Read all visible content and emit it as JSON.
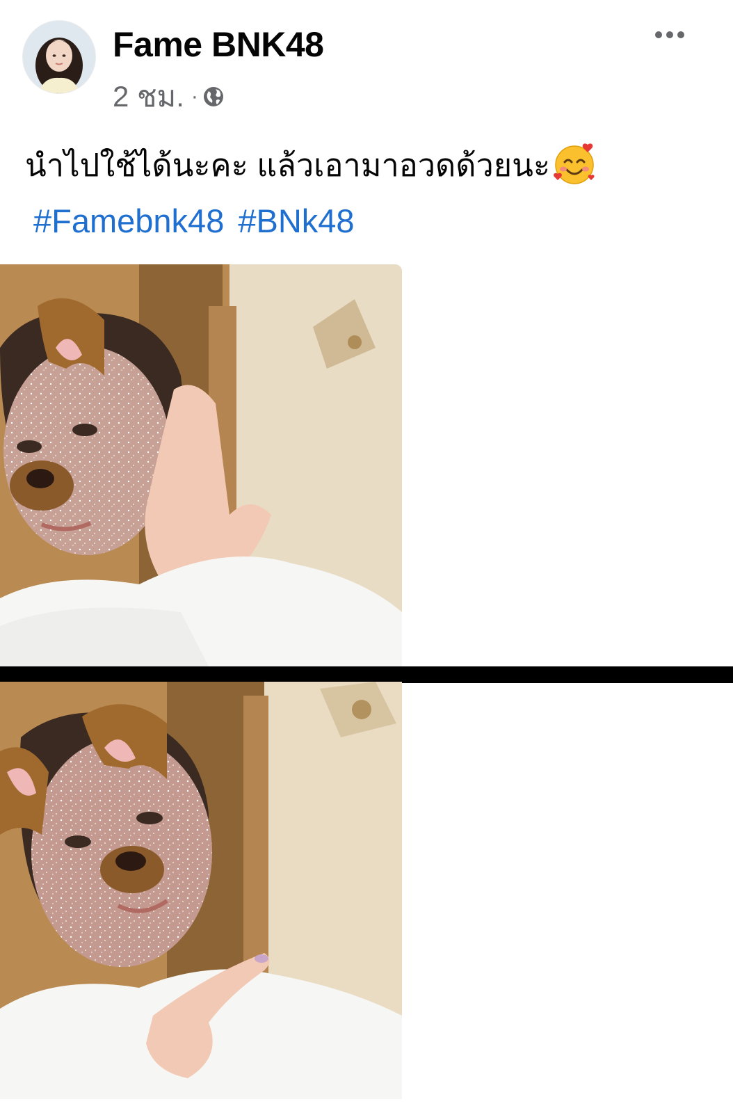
{
  "post": {
    "author": "Fame BNK48",
    "time": "2 ชม.",
    "separator": "·",
    "privacy_icon": "globe-icon",
    "more_icon": "more-options-icon",
    "text": "นำไปใช้ได้นะคะ แล้วเอามาอวดด้วยนะ",
    "emoji": "smiling-face-with-hearts-icon",
    "hashtags": [
      "#Famebnk48",
      "#BNk48"
    ]
  },
  "colors": {
    "hashtag": "#1f6fd1",
    "meta": "#65676b",
    "divider": "#000000"
  }
}
